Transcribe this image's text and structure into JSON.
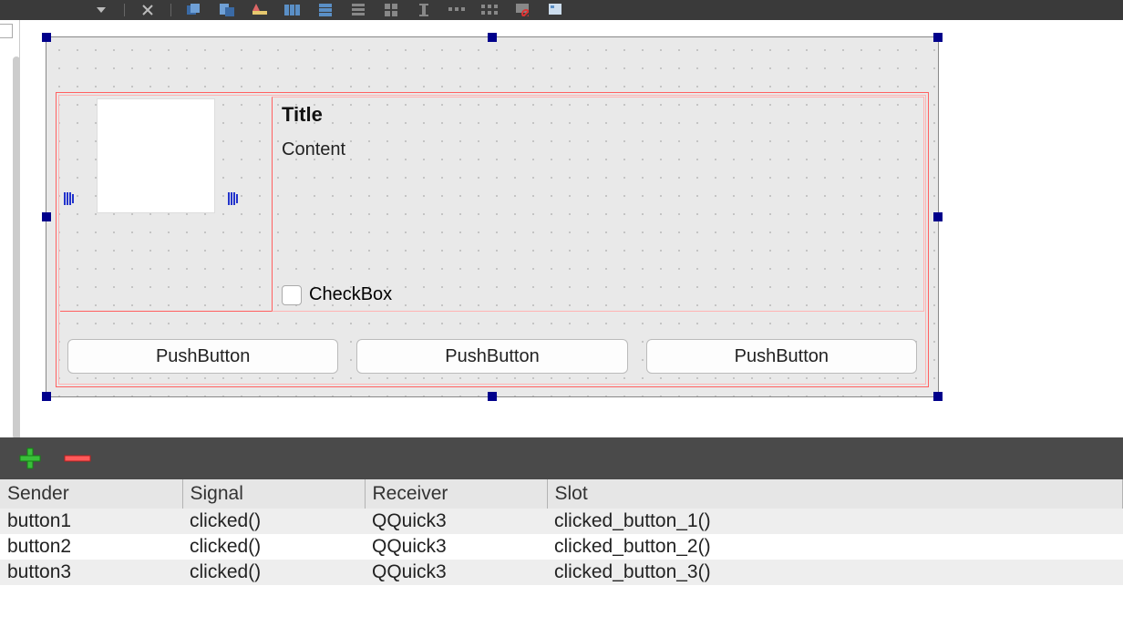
{
  "form": {
    "title_label": "Title",
    "content_label": "Content",
    "checkbox_label": "CheckBox",
    "buttons": [
      {
        "label": "PushButton"
      },
      {
        "label": "PushButton"
      },
      {
        "label": "PushButton"
      }
    ]
  },
  "signals": {
    "headers": {
      "sender": "Sender",
      "signal": "Signal",
      "receiver": "Receiver",
      "slot": "Slot"
    },
    "rows": [
      {
        "sender": "button1",
        "signal": "clicked()",
        "receiver": "QQuick3",
        "slot": "clicked_button_1()"
      },
      {
        "sender": "button2",
        "signal": "clicked()",
        "receiver": "QQuick3",
        "slot": "clicked_button_2()"
      },
      {
        "sender": "button3",
        "signal": "clicked()",
        "receiver": "QQuick3",
        "slot": "clicked_button_3()"
      }
    ]
  }
}
